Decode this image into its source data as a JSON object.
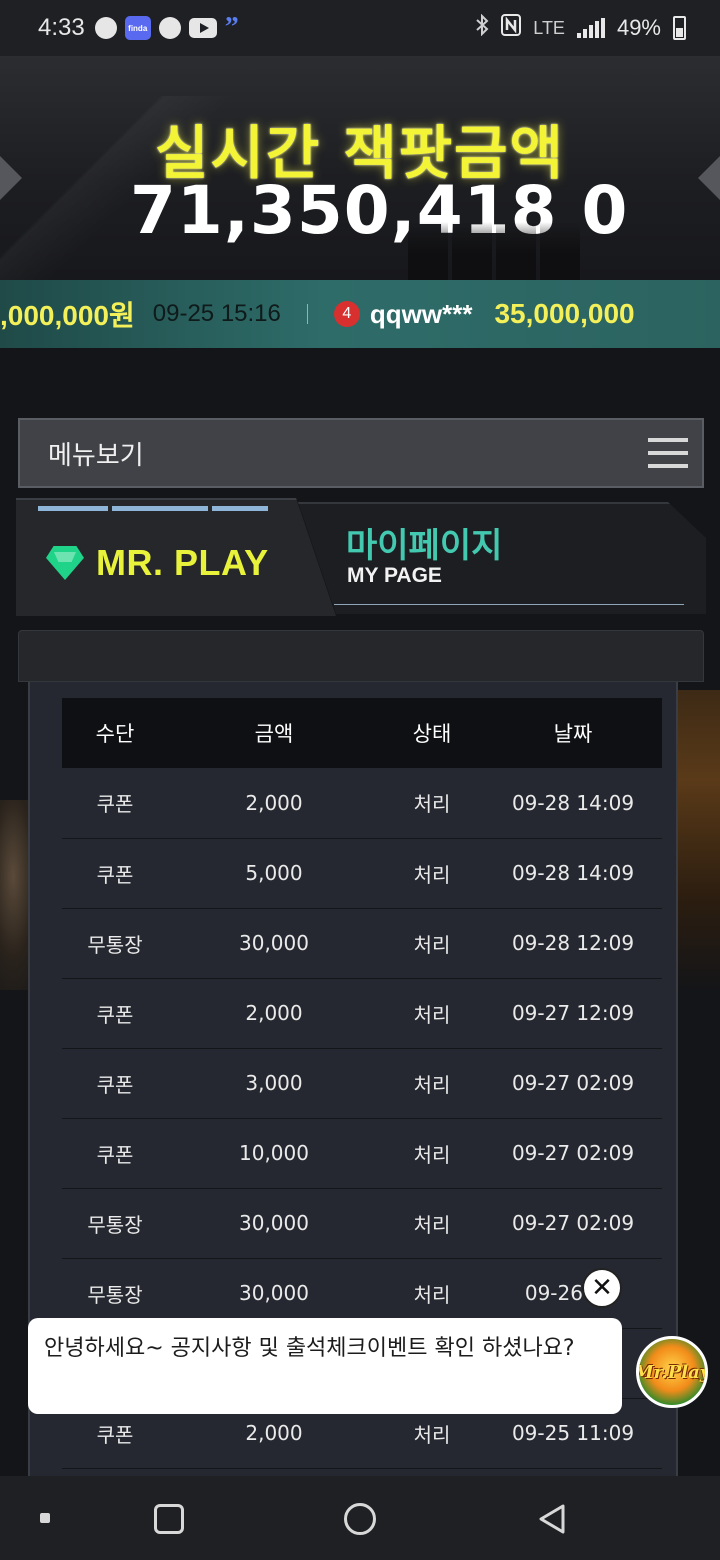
{
  "status_bar": {
    "time": "4:33",
    "app_icon_label": "finda",
    "network": "LTE",
    "battery": "49%",
    "icons": [
      "chat-bubble-icon",
      "finda-icon",
      "chat-bubble-icon",
      "youtube-icon",
      "quote-icon",
      "bluetooth-icon",
      "nfc-icon",
      "lte-icon",
      "signal-icon",
      "battery-icon"
    ]
  },
  "jackpot": {
    "title": "실시간 잭팟금액",
    "amount": "71,350,418 0"
  },
  "ticker": {
    "prev_amount": ",000,000원",
    "date": "09-25 15:16",
    "rank": "4",
    "user": "qqww***",
    "amount": "35,000,000"
  },
  "menu": {
    "label": "메뉴보기",
    "icon": "hamburger-icon"
  },
  "panel": {
    "brand": "MR. PLAY",
    "title_ko": "마이페이지",
    "title_en": "MY PAGE",
    "brand_color": "#e9f23a",
    "title_color": "#43c9b0"
  },
  "table": {
    "headers": [
      "수단",
      "금액",
      "상태",
      "날짜"
    ],
    "rows": [
      [
        "쿠폰",
        "2,000",
        "처리",
        "09-28 14:09"
      ],
      [
        "쿠폰",
        "5,000",
        "처리",
        "09-28 14:09"
      ],
      [
        "무통장",
        "30,000",
        "처리",
        "09-28 12:09"
      ],
      [
        "쿠폰",
        "2,000",
        "처리",
        "09-27 12:09"
      ],
      [
        "쿠폰",
        "3,000",
        "처리",
        "09-27 02:09"
      ],
      [
        "쿠폰",
        "10,000",
        "처리",
        "09-27 02:09"
      ],
      [
        "무통장",
        "30,000",
        "처리",
        "09-27 02:09"
      ],
      [
        "무통장",
        "30,000",
        "처리",
        "09-26 2 9"
      ],
      [
        "",
        "",
        "",
        ""
      ],
      [
        "쿠폰",
        "2,000",
        "처리",
        "09-25 11:09"
      ]
    ]
  },
  "chat": {
    "close": "✕",
    "message": "안녕하세요~ 공지사항 및 출석체크이벤트 확인 하셨나요?",
    "avatar_text": "Mr.Play"
  },
  "nav": {
    "icons": [
      "menu-dot-icon",
      "recent-apps-icon",
      "home-icon",
      "back-icon"
    ]
  }
}
